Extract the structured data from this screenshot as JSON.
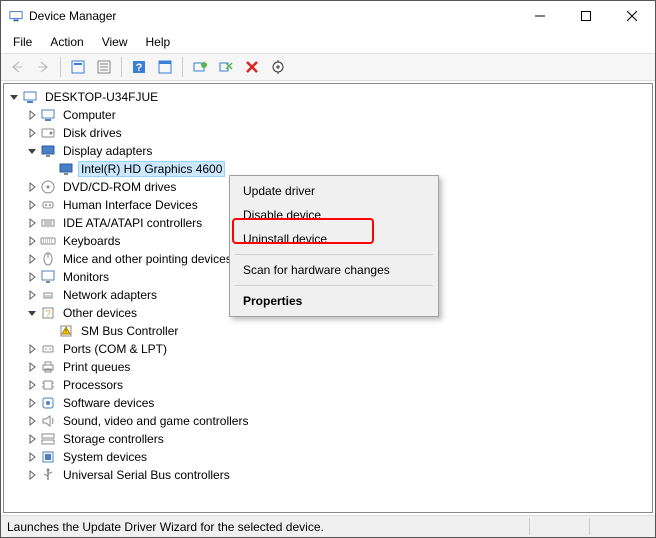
{
  "window": {
    "title": "Device Manager"
  },
  "menubar": {
    "items": [
      "File",
      "Action",
      "View",
      "Help"
    ]
  },
  "toolbar": {
    "buttons": [
      {
        "name": "back-icon",
        "disabled": true
      },
      {
        "name": "forward-icon",
        "disabled": true
      },
      {
        "sep": true
      },
      {
        "name": "show-hidden-icon"
      },
      {
        "name": "properties-icon"
      },
      {
        "sep": true
      },
      {
        "name": "help-icon"
      },
      {
        "name": "scan-icon"
      },
      {
        "sep": true
      },
      {
        "name": "update-driver-icon"
      },
      {
        "name": "disable-icon"
      },
      {
        "name": "uninstall-icon"
      },
      {
        "name": "scan-hw-icon"
      }
    ]
  },
  "tree": {
    "root": {
      "label": "DESKTOP-U34FJUE",
      "expanded": true,
      "icon": "computer"
    },
    "children": [
      {
        "label": "Computer",
        "expanded": false,
        "icon": "computer"
      },
      {
        "label": "Disk drives",
        "expanded": false,
        "icon": "disk"
      },
      {
        "label": "Display adapters",
        "expanded": true,
        "icon": "display",
        "children": [
          {
            "label": "Intel(R) HD Graphics 4600",
            "icon": "display",
            "leaf": true,
            "selected": true
          }
        ]
      },
      {
        "label": "DVD/CD-ROM drives",
        "expanded": false,
        "icon": "cdrom"
      },
      {
        "label": "Human Interface Devices",
        "expanded": false,
        "icon": "hid"
      },
      {
        "label": "IDE ATA/ATAPI controllers",
        "expanded": false,
        "icon": "ide"
      },
      {
        "label": "Keyboards",
        "expanded": false,
        "icon": "keyboard"
      },
      {
        "label": "Mice and other pointing devices",
        "expanded": false,
        "icon": "mouse"
      },
      {
        "label": "Monitors",
        "expanded": false,
        "icon": "monitor"
      },
      {
        "label": "Network adapters",
        "expanded": false,
        "icon": "network"
      },
      {
        "label": "Other devices",
        "expanded": true,
        "icon": "other",
        "children": [
          {
            "label": "SM Bus Controller",
            "icon": "warn",
            "leaf": true
          }
        ]
      },
      {
        "label": "Ports (COM & LPT)",
        "expanded": false,
        "icon": "port"
      },
      {
        "label": "Print queues",
        "expanded": false,
        "icon": "printer"
      },
      {
        "label": "Processors",
        "expanded": false,
        "icon": "cpu"
      },
      {
        "label": "Software devices",
        "expanded": false,
        "icon": "software"
      },
      {
        "label": "Sound, video and game controllers",
        "expanded": false,
        "icon": "sound"
      },
      {
        "label": "Storage controllers",
        "expanded": false,
        "icon": "storage"
      },
      {
        "label": "System devices",
        "expanded": false,
        "icon": "system"
      },
      {
        "label": "Universal Serial Bus controllers",
        "expanded": false,
        "icon": "usb"
      }
    ]
  },
  "context_menu": {
    "items": [
      {
        "label": "Update driver"
      },
      {
        "label": "Disable device"
      },
      {
        "label": "Uninstall device",
        "highlight": true
      },
      {
        "sep": true
      },
      {
        "label": "Scan for hardware changes"
      },
      {
        "sep": true
      },
      {
        "label": "Properties",
        "bold": true
      }
    ]
  },
  "statusbar": {
    "text": "Launches the Update Driver Wizard for the selected device."
  }
}
